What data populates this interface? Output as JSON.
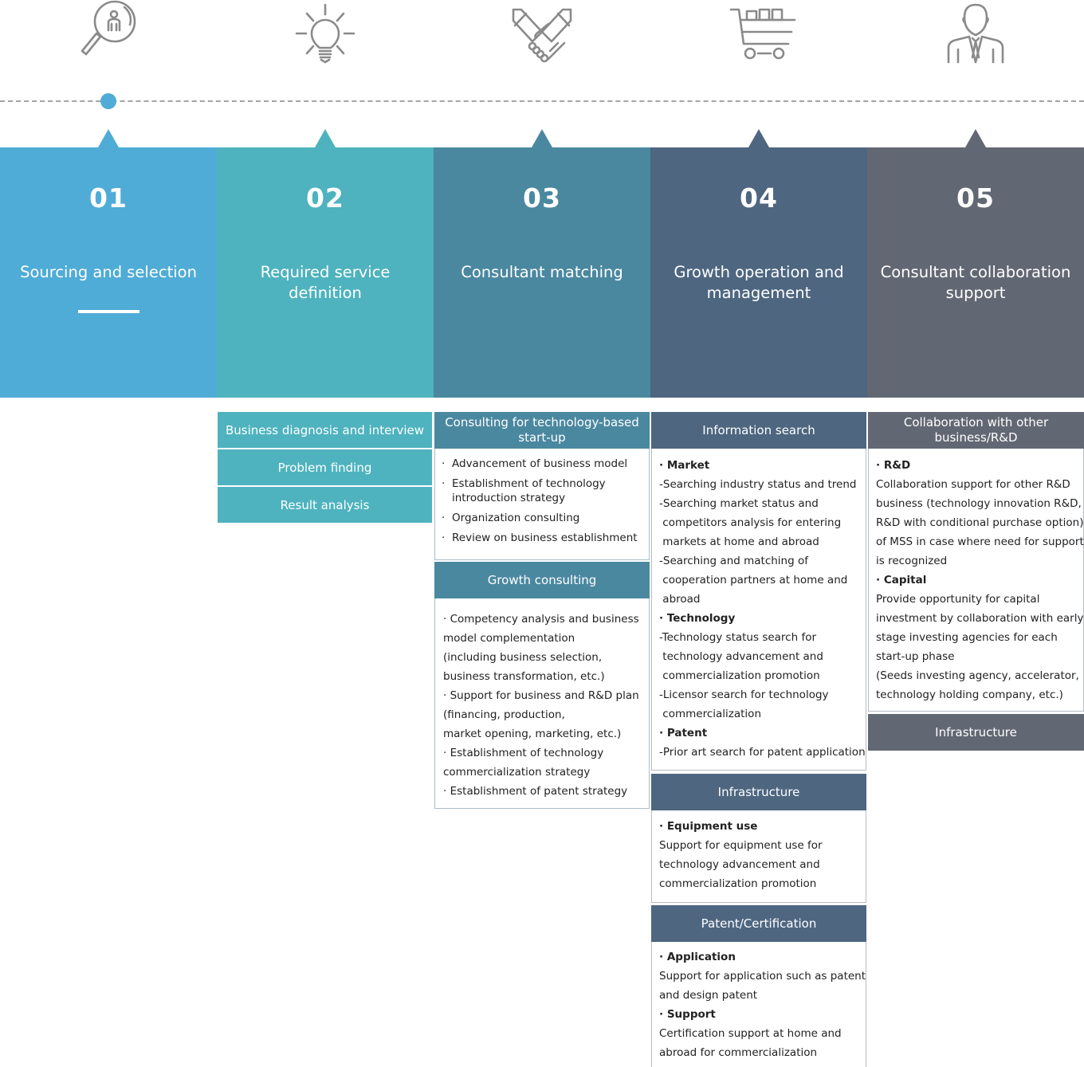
{
  "icons": [
    "magnifier-person-icon",
    "lightbulb-icon",
    "handshake-icon",
    "shopping-cart-icon",
    "businessman-icon"
  ],
  "colors": {
    "step1": "#4facd6",
    "step2": "#4eb3be",
    "step3": "#4a88a0",
    "step4": "#4e6680",
    "step5": "#626873",
    "timeline": "#a3a3a3",
    "icon_stroke": "#8a8a8a"
  },
  "active_step": 1,
  "steps": [
    {
      "num": "01",
      "title": "Sourcing and selection"
    },
    {
      "num": "02",
      "title": "Required service definition"
    },
    {
      "num": "03",
      "title": "Consultant matching"
    },
    {
      "num": "04",
      "title": "Growth operation and management"
    },
    {
      "num": "05",
      "title": "Consultant collaboration support"
    }
  ],
  "step2_items": [
    "Business diagnosis and interview",
    "Problem finding",
    "Result analysis"
  ],
  "step3": {
    "startup": {
      "header": "Consulting for technology-based start-up",
      "items": [
        "Advancement of business model",
        "Establishment of technology introduction strategy",
        "Organization consulting",
        "Review on business establishment"
      ]
    },
    "growth": {
      "header": "Growth consulting",
      "lines": [
        "· Competency analysis and business",
        "model complementation",
        "(including business selection,",
        "business transformation, etc.)",
        "· Support for business and R&D plan",
        "(financing, production,",
        "market opening, marketing, etc.)",
        "· Establishment of technology",
        "commercialization strategy",
        "· Establishment of patent strategy"
      ]
    }
  },
  "step4": {
    "info": {
      "header": "Information search",
      "lines": [
        {
          "t": "· Market",
          "b": true
        },
        {
          "t": "-Searching industry status and trend"
        },
        {
          "t": "-Searching market status and"
        },
        {
          "t": " competitors analysis for entering"
        },
        {
          "t": " markets at home and abroad"
        },
        {
          "t": "-Searching and matching of"
        },
        {
          "t": " cooperation partners at home and"
        },
        {
          "t": " abroad"
        },
        {
          "t": "· Technology",
          "b": true
        },
        {
          "t": "-Technology status search for"
        },
        {
          "t": " technology advancement and"
        },
        {
          "t": " commercialization promotion"
        },
        {
          "t": "-Licensor search for technology"
        },
        {
          "t": " commercialization"
        },
        {
          "t": "· Patent",
          "b": true
        },
        {
          "t": "-Prior art search for patent application"
        }
      ]
    },
    "infra": {
      "header": "Infrastructure",
      "lines": [
        {
          "t": "· Equipment use",
          "b": true
        },
        {
          "t": "Support for equipment use for"
        },
        {
          "t": "technology advancement and"
        },
        {
          "t": "commercialization promotion"
        }
      ]
    },
    "patent": {
      "header": "Patent/Certification",
      "lines": [
        {
          "t": "· Application",
          "b": true
        },
        {
          "t": "Support for application such as patent"
        },
        {
          "t": "and design patent"
        },
        {
          "t": "· Support",
          "b": true
        },
        {
          "t": "Certification support at home and"
        },
        {
          "t": "abroad for commercialization"
        }
      ]
    }
  },
  "step5": {
    "collab": {
      "header": "Collaboration with other business/R&D",
      "lines": [
        {
          "t": "· R&D",
          "b": true
        },
        {
          "t": "Collaboration support for other R&D"
        },
        {
          "t": "business (technology innovation R&D,"
        },
        {
          "t": "R&D with conditional purchase option)"
        },
        {
          "t": "of MSS in case where need for support"
        },
        {
          "t": "is recognized"
        },
        {
          "t": "· Capital",
          "b": true
        },
        {
          "t": "Provide opportunity for capital"
        },
        {
          "t": "investment by collaboration with early"
        },
        {
          "t": "stage investing agencies for each"
        },
        {
          "t": "start-up phase"
        },
        {
          "t": "(Seeds investing agency, accelerator,"
        },
        {
          "t": "technology holding company, etc.)"
        }
      ]
    },
    "infra": {
      "header": "Infrastructure"
    }
  }
}
